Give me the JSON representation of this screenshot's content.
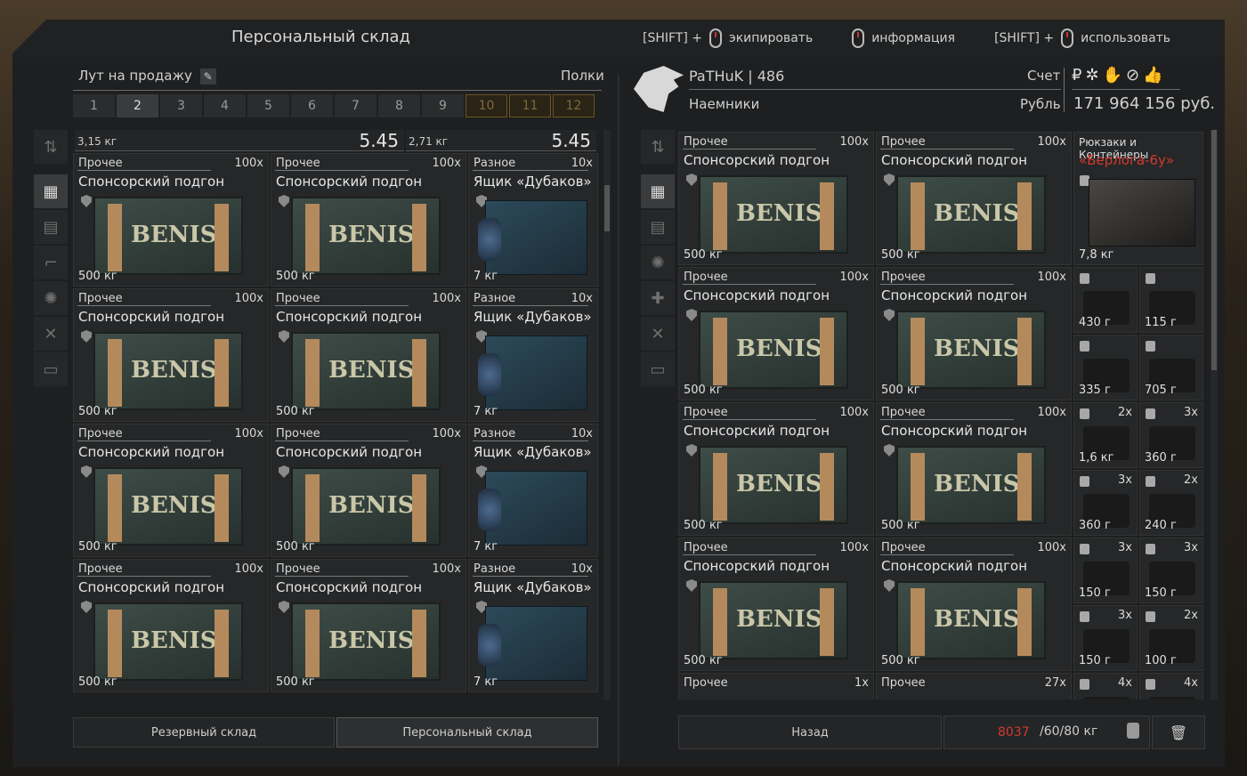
{
  "window": {
    "title": "Персональный склад"
  },
  "hints": [
    {
      "prefix": "[SHIFT] +",
      "label": "экипировать",
      "icon": "mouse-left-icon"
    },
    {
      "prefix": "",
      "label": "информация",
      "icon": "mouse-middle-icon"
    },
    {
      "prefix": "[SHIFT] +",
      "label": "использовать",
      "icon": "mouse-right-icon"
    }
  ],
  "left": {
    "filter_label": "Лут на продажу",
    "shelves_label": "Полки",
    "tabs": [
      "1",
      "2",
      "3",
      "4",
      "5",
      "6",
      "7",
      "8",
      "9",
      "10",
      "11",
      "12"
    ],
    "active_tab": "2",
    "weights": [
      {
        "weight": "3,15 кг",
        "value": "5.45"
      },
      {
        "weight": "2,71 кг",
        "value": "5.45"
      }
    ],
    "cells": [
      {
        "cat": "Прочее",
        "count": "100x",
        "name": "Спонсорский подгон",
        "weight": "500 кг",
        "kind": "crate"
      },
      {
        "cat": "Прочее",
        "count": "100x",
        "name": "Спонсорский подгон",
        "weight": "500 кг",
        "kind": "crate"
      },
      {
        "cat": "Разное",
        "count": "10x",
        "name": "Ящик «Дубаков»",
        "weight": "7 кг",
        "kind": "box"
      },
      {
        "cat": "Прочее",
        "count": "100x",
        "name": "Спонсорский подгон",
        "weight": "500 кг",
        "kind": "crate"
      },
      {
        "cat": "Прочее",
        "count": "100x",
        "name": "Спонсорский подгон",
        "weight": "500 кг",
        "kind": "crate"
      },
      {
        "cat": "Разное",
        "count": "10x",
        "name": "Ящик «Дубаков»",
        "weight": "7 кг",
        "kind": "box"
      },
      {
        "cat": "Прочее",
        "count": "100x",
        "name": "Спонсорский подгон",
        "weight": "500 кг",
        "kind": "crate"
      },
      {
        "cat": "Прочее",
        "count": "100x",
        "name": "Спонсорский подгон",
        "weight": "500 кг",
        "kind": "crate"
      },
      {
        "cat": "Разное",
        "count": "10x",
        "name": "Ящик «Дубаков»",
        "weight": "7 кг",
        "kind": "box"
      },
      {
        "cat": "Прочее",
        "count": "100x",
        "name": "Спонсорский подгон",
        "weight": "500 кг",
        "kind": "crate"
      },
      {
        "cat": "Прочее",
        "count": "100x",
        "name": "Спонсорский подгон",
        "weight": "500 кг",
        "kind": "crate"
      },
      {
        "cat": "Разное",
        "count": "10x",
        "name": "Ящик «Дубаков»",
        "weight": "7 кг",
        "kind": "box"
      }
    ],
    "buttons": {
      "reserve": "Резервный склад",
      "personal": "Персональный склад"
    }
  },
  "right": {
    "player": "PaTHuK | 486",
    "faction": "Наемники",
    "account_label": "Счет",
    "currency_label": "Рубль",
    "balance": "171 964 156 руб.",
    "cells": [
      {
        "cat": "Прочее",
        "count": "100x",
        "name": "Спонсорский подгон",
        "weight": "500 кг"
      },
      {
        "cat": "Прочее",
        "count": "100x",
        "name": "Спонсорский подгон",
        "weight": "500 кг"
      },
      {
        "cat": "Прочее",
        "count": "100x",
        "name": "Спонсорский подгон",
        "weight": "500 кг"
      },
      {
        "cat": "Прочее",
        "count": "100x",
        "name": "Спонсорский подгон",
        "weight": "500 кг"
      },
      {
        "cat": "Прочее",
        "count": "100x",
        "name": "Спонсорский подгон",
        "weight": "500 кг"
      },
      {
        "cat": "Прочее",
        "count": "100x",
        "name": "Спонсорский подгон",
        "weight": "500 кг"
      },
      {
        "cat": "Прочее",
        "count": "100x",
        "name": "Спонсорский подгон",
        "weight": "500 кг"
      },
      {
        "cat": "Прочее",
        "count": "100x",
        "name": "Спонсорский подгон",
        "weight": "500 кг"
      }
    ],
    "bottom_cells": [
      {
        "cat": "Прочее",
        "count": "1x"
      },
      {
        "cat": "Прочее",
        "count": "27x"
      }
    ],
    "backpack": {
      "cat": "Рюкзаки и Контейнеры",
      "name": "«Берлога-6у»",
      "weight": "7,8 кг"
    },
    "small_items": [
      {
        "weight": "430 г",
        "count": ""
      },
      {
        "weight": "115 г",
        "count": ""
      },
      {
        "weight": "335 г",
        "count": ""
      },
      {
        "weight": "705 г",
        "count": ""
      },
      {
        "weight": "1,6 кг",
        "count": "2x"
      },
      {
        "weight": "360 г",
        "count": "3x"
      },
      {
        "weight": "360 г",
        "count": "3x"
      },
      {
        "weight": "240 г",
        "count": "2x"
      },
      {
        "weight": "150 г",
        "count": "3x"
      },
      {
        "weight": "150 г",
        "count": "3x"
      },
      {
        "weight": "150 г",
        "count": "3x"
      },
      {
        "weight": "100 г",
        "count": "2x"
      },
      {
        "weight": "",
        "count": "4x"
      },
      {
        "weight": "",
        "count": "4x"
      }
    ],
    "back_button": "Назад",
    "capacity": {
      "current": "8037",
      "rest": "/60/80 кг"
    }
  },
  "colors": {
    "warning": "#d23a2f",
    "locked_tab": "#7d6a3a"
  }
}
